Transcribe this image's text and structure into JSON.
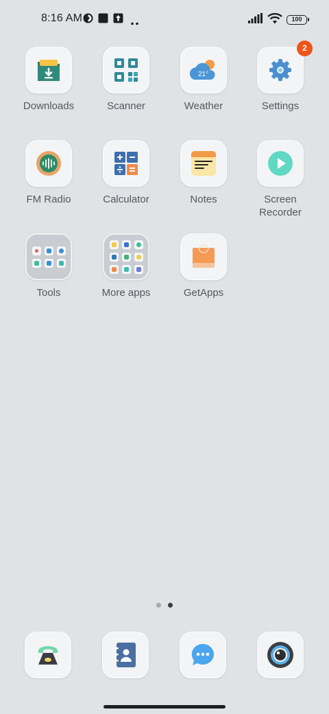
{
  "status_bar": {
    "time": "8:16 AM",
    "battery": "100",
    "icons": [
      "data-saver-icon",
      "square-notification-icon",
      "upload-arrow-icon",
      "more-dots-icon",
      "cell-signal-icon",
      "wifi-icon",
      "battery-icon"
    ]
  },
  "apps": [
    {
      "label": "Downloads",
      "icon": "download-folder-icon"
    },
    {
      "label": "Scanner",
      "icon": "qr-scanner-icon"
    },
    {
      "label": "Weather",
      "icon": "weather-cloud-sun-icon",
      "temp": "21°"
    },
    {
      "label": "Settings",
      "icon": "gear-icon",
      "badge": "2"
    },
    {
      "label": "FM Radio",
      "icon": "radio-waves-icon"
    },
    {
      "label": "Calculator",
      "icon": "calculator-icon"
    },
    {
      "label": "Notes",
      "icon": "notes-icon"
    },
    {
      "label_line1": "Screen",
      "label_line2": "Recorder",
      "icon": "play-record-icon"
    },
    {
      "label": "Tools",
      "icon": "folder-icon"
    },
    {
      "label": "More apps",
      "icon": "folder-icon"
    },
    {
      "label": "GetApps",
      "icon": "shopping-bag-icon"
    }
  ],
  "pager": {
    "pages": 2,
    "active": 2
  },
  "dock": [
    {
      "icon": "phone-icon"
    },
    {
      "icon": "contacts-icon"
    },
    {
      "icon": "messages-icon"
    },
    {
      "icon": "camera-icon"
    }
  ],
  "colors": {
    "background": "#dfe3e6",
    "badge": "#ef5418",
    "tile": "#f3f4f5",
    "label": "#54585c"
  }
}
